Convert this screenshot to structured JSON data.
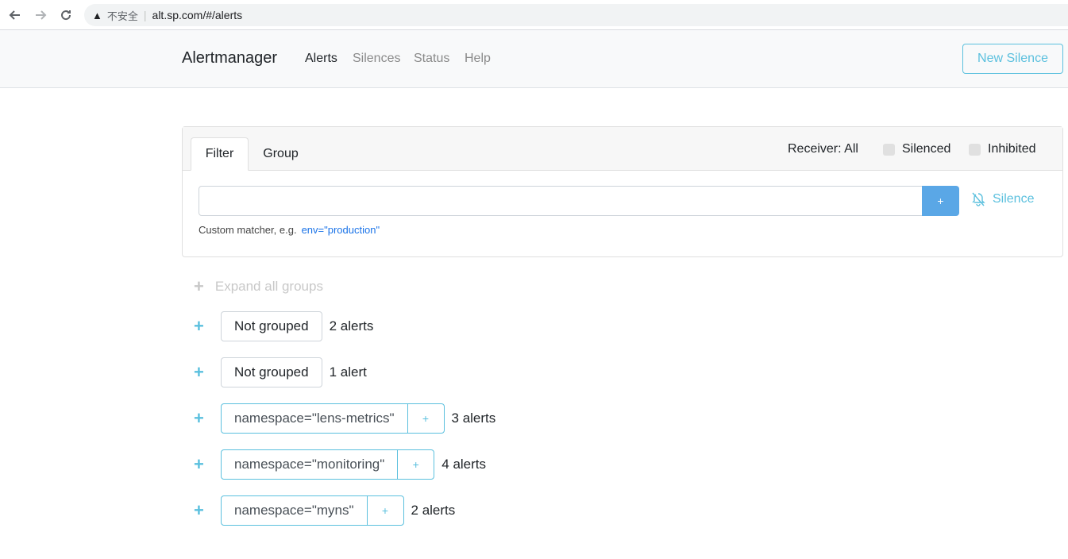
{
  "browser": {
    "insecure_label": "不安全",
    "url": "alt.sp.com/#/alerts"
  },
  "navbar": {
    "brand": "Alertmanager",
    "links": [
      "Alerts",
      "Silences",
      "Status",
      "Help"
    ],
    "active": "Alerts",
    "new_silence_label": "New Silence"
  },
  "filter": {
    "tabs": [
      "Filter",
      "Group"
    ],
    "active_tab": "Filter",
    "receiver_label": "Receiver: All",
    "silenced_label": "Silenced",
    "inhibited_label": "Inhibited",
    "input_value": "",
    "add_button_label": "+",
    "silence_link_label": "Silence",
    "hint_text": "Custom matcher, e.g.",
    "hint_example": "env=\"production\""
  },
  "groups": {
    "expand_all_label": "Expand all groups",
    "items": [
      {
        "label": "Not grouped",
        "count": "2 alerts"
      },
      {
        "label": "Not grouped",
        "count": "1 alert"
      },
      {
        "label": "namespace=\"lens-metrics\"",
        "count": "3 alerts"
      },
      {
        "label": "namespace=\"monitoring\"",
        "count": "4 alerts"
      },
      {
        "label": "namespace=\"myns\"",
        "count": "2 alerts"
      }
    ]
  },
  "colors": {
    "accent": "#5bc0de",
    "primary_button": "#5aa7e6",
    "link_code": "#1a73e8"
  },
  "icons": [
    "back-arrow-icon",
    "forward-arrow-icon",
    "reload-icon",
    "warning-icon",
    "bell-slash-icon",
    "plus-icon"
  ]
}
